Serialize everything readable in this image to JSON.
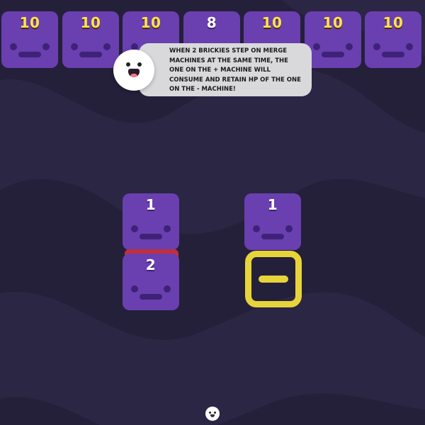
{
  "top_bricks": [
    {
      "hp": "10",
      "highlight": true
    },
    {
      "hp": "10",
      "highlight": true
    },
    {
      "hp": "10",
      "highlight": true
    },
    {
      "hp": "8",
      "highlight": false
    },
    {
      "hp": "10",
      "highlight": true
    },
    {
      "hp": "10",
      "highlight": true
    },
    {
      "hp": "10",
      "highlight": true
    }
  ],
  "tutorial": {
    "message": "WHEN 2 BRICKIES STEP ON MERGE MACHINES AT THE SAME TIME, THE ONE ON THE + MACHINE WILL CONSUME AND RETAIN HP OF THE ONE ON THE - MACHINE!"
  },
  "board": {
    "left_top_brick_hp": "1",
    "left_bottom_brick_hp": "2",
    "right_brick_hp": "1"
  },
  "colors": {
    "background": "#24203a",
    "brick": "#6a3fb0",
    "hp_highlight": "#ffe34a",
    "plus_machine": "#c0303c",
    "minus_machine": "#e7d43a",
    "bubble": "#d9d9dc"
  },
  "icons": {
    "guide": "mascot-face-icon",
    "minus_machine": "minus-machine-icon",
    "footer": "mini-mascot-icon"
  }
}
